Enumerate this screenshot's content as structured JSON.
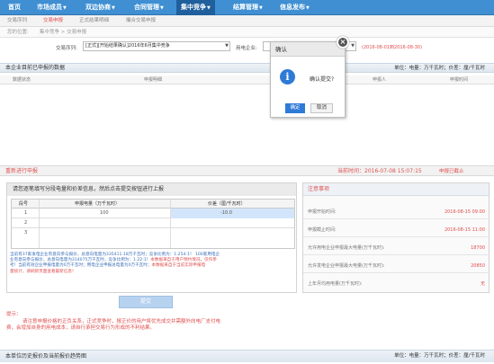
{
  "nav": {
    "items": [
      {
        "label": "首页",
        "caret": ""
      },
      {
        "label": "市场成员",
        "caret": "▼"
      },
      {
        "label": "双边协商",
        "caret": "▼"
      },
      {
        "label": "合同管理",
        "caret": "▼"
      },
      {
        "label": "集中竞争",
        "caret": "▼"
      },
      {
        "label": "结算管理",
        "caret": "▼"
      },
      {
        "label": "信息发布",
        "caret": "▼"
      }
    ]
  },
  "subtabs": [
    "交易序列",
    "交易申报",
    "正式结果明细",
    "撮合交易申报"
  ],
  "breadcrumb": {
    "label": "您的位置:",
    "path": "集中竞争 > 交易申报"
  },
  "filter": {
    "seq_label": "交易序列:",
    "seq_value": "[正式][开始结果确认]2016年6月集中竞争",
    "period_label": "用电企业:",
    "period_value": "",
    "date_range": "(2016-08-01到2016-08-30)"
  },
  "section1": {
    "title": "本企业目前已申报的数据",
    "unit": "单位：电量：万千瓦时；价差：厘/千瓦时"
  },
  "table1": {
    "columns": [
      "数据状态",
      "申报明细",
      "申报人",
      "申报时间"
    ]
  },
  "section2": {
    "title": "重新进行申报",
    "time": "当前时间：2016-07-08 15:07:15",
    "closed": "申报已截止"
  },
  "instructions": "请您逐笔填写分段电量和价差信息，然后点击提交按钮进行上报",
  "grid": {
    "columns": [
      "段号",
      "申报电量（万千瓦时）",
      "价差（厘/千瓦时）"
    ],
    "rows": [
      {
        "no": "1",
        "qty": "100",
        "price": "-10.0"
      },
      {
        "no": "2",
        "qty": "",
        "price": ""
      },
      {
        "no": "3",
        "qty": "",
        "price": ""
      }
    ]
  },
  "notes": {
    "line1": "当前有37家发电企业有意向参与报价，总意向电量为335411.18万千瓦时；竞争比例为：1.254:1！ 100家用电企",
    "line2": "业有意向参与报价，总意向电量为314075万千瓦时，竞争比例为：1.22:1！",
    "red1": "本数据来自于用户预约情况，仅作参",
    "line3": "考！",
    "line4": "当前有效企业申报电量为0万千瓦时；用电企业申报总电量为0万千瓦时；",
    "red2": "本数据来自于当前实际申报电",
    "line5": "量统计，请刷新页面查看最新信息！"
  },
  "submit_label": "提交",
  "tips": {
    "label": "提示：",
    "line1": "请注意申报价格的正负关系，正式竞争时，报正价的用户将优先成交并需额外向电厂支付电",
    "line2": "费，会增加自身的用电成本，请自行承担交易行为形成的不利结果。"
  },
  "notice": {
    "title": "注意事项",
    "rows": [
      {
        "k": "申报开始时间:",
        "v": "2016-08-15 09:00"
      },
      {
        "k": "申报截止时间:",
        "v": "2016-08-15 11:00"
      },
      {
        "k": "允许用电企业申报最大电量(万千瓦时):",
        "v": "18700"
      },
      {
        "k": "允许发电企业申报最大电量(万千瓦时):",
        "v": "20850"
      },
      {
        "k": "上年月均用电量(万千瓦时):",
        "v": "无"
      }
    ]
  },
  "bottom": {
    "title": "本单位历史报价及当前报价趋势图",
    "unit": "单位：电量：万千瓦时；价差：厘/千瓦时"
  },
  "modal": {
    "title": "确认",
    "message": "确认提交?",
    "ok": "确定",
    "cancel": "取消",
    "close": "×",
    "icon": "i"
  },
  "colors": {
    "nav": "#3f8fd2",
    "accent_red": "#e04f4f",
    "modal_blue": "#2e7ad6"
  }
}
